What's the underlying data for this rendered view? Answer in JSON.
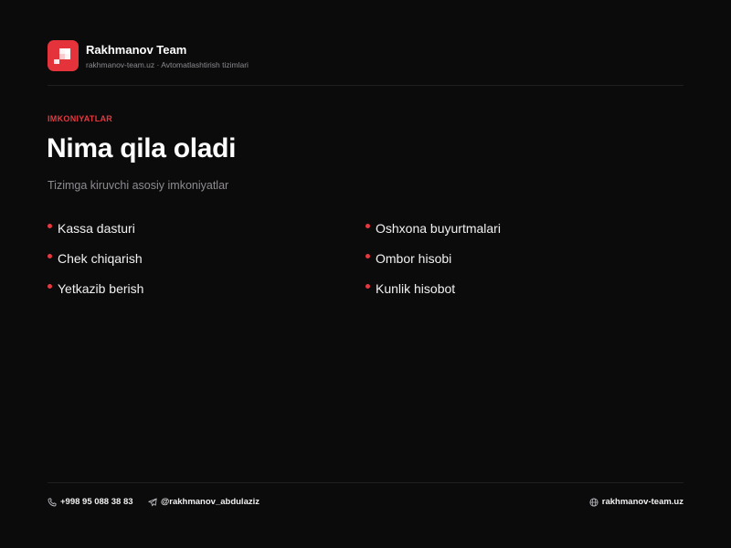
{
  "brand": {
    "name": "Rakhmanov Team",
    "subtitle": "rakhmanov-team.uz · Avtomatlashtirish tizimlari",
    "logo_icon": "red-square-arrow-logo",
    "accent_color": "#e5333c"
  },
  "section": {
    "eyebrow": "IMKONIYATLAR",
    "title": "Nima qila oladi",
    "subtitle": "Tizimga kiruvchi asosiy imkoniyatlar"
  },
  "features": [
    "Kassa dasturi",
    "Oshxona buyurtmalari",
    "Chek chiqarish",
    "Ombor hisobi",
    "Yetkazib berish",
    "Kunlik hisobot"
  ],
  "footer": {
    "phone": {
      "icon": "phone-icon",
      "label": "+998 95 088 38 83"
    },
    "telegram": {
      "icon": "telegram-icon",
      "label": "@rakhmanov_abdulaziz"
    },
    "website": {
      "icon": "globe-icon",
      "label": "rakhmanov-team.uz"
    }
  },
  "colors": {
    "background": "#0c0b0c",
    "accent": "#e5383f",
    "muted_text": "#8d8b90"
  }
}
